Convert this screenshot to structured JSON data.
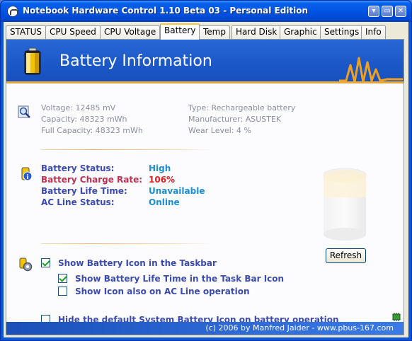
{
  "window": {
    "title": "Notebook Hardware Control 1.10 Beta 03  -  Personal Edition",
    "controls": [
      "minimize",
      "maximize",
      "close"
    ]
  },
  "tabs": [
    {
      "label": "STATUS"
    },
    {
      "label": "CPU Speed"
    },
    {
      "label": "CPU Voltage"
    },
    {
      "label": "Battery",
      "active": true
    },
    {
      "label": "Temp"
    },
    {
      "label": "Hard Disk"
    },
    {
      "label": "Graphic"
    },
    {
      "label": "Settings"
    },
    {
      "label": "Info"
    }
  ],
  "header": {
    "title": "Battery Information"
  },
  "info": {
    "voltage": "Voltage:  12485 mV",
    "capacity": "Capacity:  48323 mWh",
    "full_capacity": "Full Capacity:  48323 mWh",
    "type": "Type:  Rechargeable battery",
    "manufacturer": "Manufacturer:  ASUSTEK",
    "wear_level": "Wear Level:  4 %"
  },
  "status": {
    "battery_status_label": "Battery Status:",
    "battery_status_value": "High",
    "charge_rate_label": "Battery Charge Rate:",
    "charge_rate_value": "106%",
    "life_time_label": "Battery Life Time:",
    "life_time_value": "Unavailable",
    "ac_line_label": "AC Line Status:",
    "ac_line_value": "Online"
  },
  "options": {
    "show_taskbar_icon": "Show Battery Icon in the Taskbar",
    "show_life_time": "Show Battery Life Time in the Task Bar Icon",
    "show_on_ac": "Show Icon also on AC Line operation",
    "hide_default": "Hide the default System Battery Icon on battery operation",
    "refresh_label": "Refresh"
  },
  "footer": {
    "text": "(c) 2006 by Manfred Jaider  -  www.pbus-167.com"
  },
  "colors": {
    "status_blue": "#3b4bb0",
    "value_cyan": "#1a8fd6",
    "value_red": "#e02020",
    "accent_orange": "#e8a83a"
  }
}
